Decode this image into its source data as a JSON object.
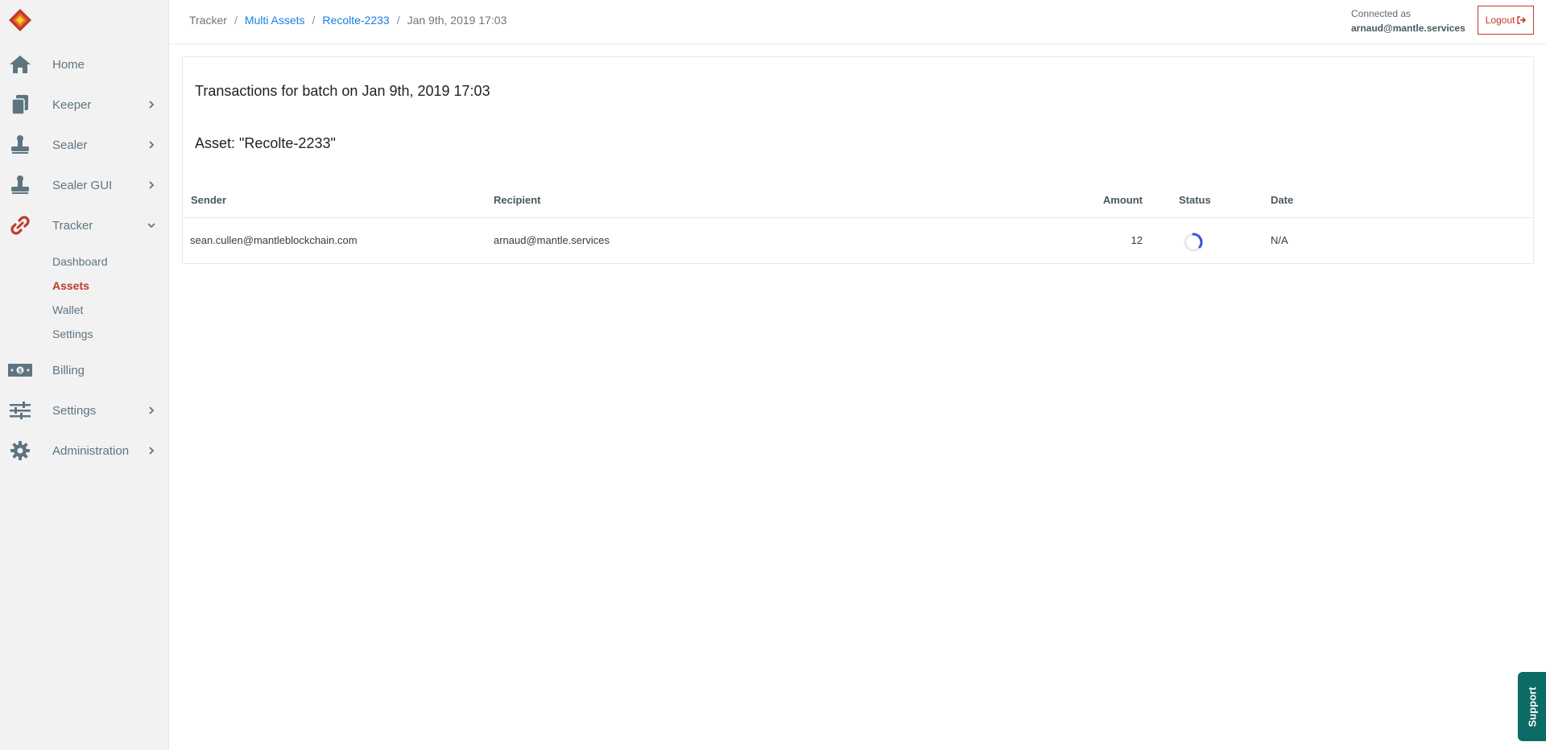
{
  "sidebar": {
    "items": [
      {
        "id": "home",
        "label": "Home",
        "icon": "home-icon",
        "chevron": false
      },
      {
        "id": "keeper",
        "label": "Keeper",
        "icon": "documents-icon",
        "chevron": true
      },
      {
        "id": "sealer",
        "label": "Sealer",
        "icon": "stamp-icon",
        "chevron": true
      },
      {
        "id": "sealer-gui",
        "label": "Sealer GUI",
        "icon": "stamp-icon",
        "chevron": true
      },
      {
        "id": "tracker",
        "label": "Tracker",
        "icon": "link-icon",
        "chevron": true,
        "expanded": true
      },
      {
        "id": "billing",
        "label": "Billing",
        "icon": "money-icon",
        "chevron": false
      },
      {
        "id": "settings",
        "label": "Settings",
        "icon": "sliders-icon",
        "chevron": true
      },
      {
        "id": "administration",
        "label": "Administration",
        "icon": "gear-icon",
        "chevron": true
      }
    ],
    "tracker_sub": [
      "Dashboard",
      "Assets",
      "Wallet",
      "Settings"
    ],
    "active_sub": "Assets"
  },
  "header": {
    "breadcrumb": [
      "Tracker",
      "Multi Assets",
      "Recolte-2233",
      "Jan 9th, 2019 17:03"
    ],
    "connected_label": "Connected as",
    "user": "arnaud@mantle.services",
    "logout_label": "Logout"
  },
  "main": {
    "title": "Transactions for batch on Jan 9th, 2019 17:03",
    "asset_line": "Asset: \"Recolte-2233\"",
    "columns": [
      "Sender",
      "Recipient",
      "Amount",
      "Status",
      "Date"
    ],
    "rows": [
      {
        "sender": "sean.cullen@mantleblockchain.com",
        "recipient": "arnaud@mantle.services",
        "amount": "12",
        "status": "loading",
        "date": "N/A"
      }
    ]
  },
  "support_label": "Support",
  "colors": {
    "accent_red": "#c0392b",
    "link_blue": "#1a7ee0",
    "icon_slate": "#5f7481",
    "support_teal": "#0c6b64"
  }
}
